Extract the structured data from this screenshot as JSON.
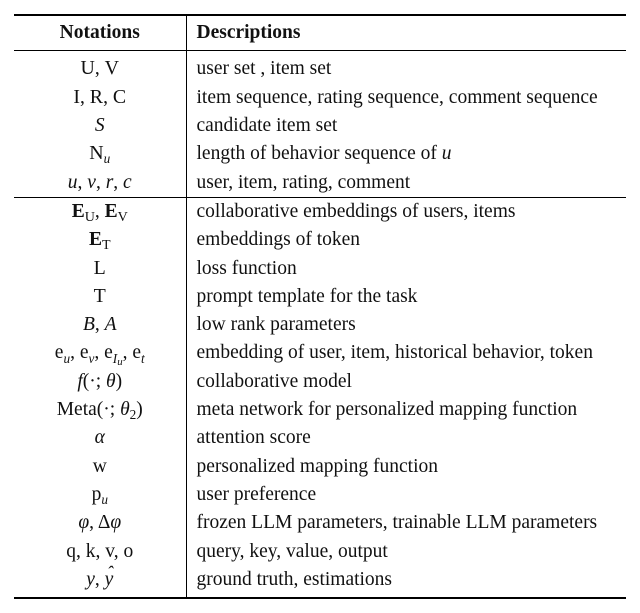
{
  "headers": {
    "notation": "Notations",
    "description": "Descriptions"
  },
  "rows": [
    {
      "n": "𝒰, 𝒱",
      "d": "user set , item set",
      "group_start": false
    },
    {
      "n": "ℐ, ℛ, 𝒞",
      "d": "item sequence, rating sequence, comment sequence"
    },
    {
      "n": "S",
      "d": "candidate item set"
    },
    {
      "n": "𝒩_u",
      "d": "length of behavior sequence of u"
    },
    {
      "n": "u, v, r, c",
      "d": "user, item, rating, comment"
    },
    {
      "n": "E_𝒰, E_𝒱",
      "d": "collaborative embeddings of users, items",
      "group_start": true
    },
    {
      "n": "E_𝒯",
      "d": "embeddings of token"
    },
    {
      "n": "ℒ",
      "d": "loss function"
    },
    {
      "n": "𝒯",
      "d": "prompt template for the task"
    },
    {
      "n": "B, A",
      "d": "low rank parameters"
    },
    {
      "n": "e_u, e_v, e_{I_u}, e_t",
      "d": "embedding of user, item, historical behavior, token"
    },
    {
      "n": "f(·;θ)",
      "d": "collaborative model"
    },
    {
      "n": "Meta(·;θ_2)",
      "d": "meta network for personalized mapping function"
    },
    {
      "n": "α",
      "d": "attention score"
    },
    {
      "n": "w",
      "d": "personalized mapping function"
    },
    {
      "n": "p_u",
      "d": "user preference"
    },
    {
      "n": "φ, Δφ",
      "d": "frozen LLM parameters, trainable LLM parameters"
    },
    {
      "n": "q, k, v, o",
      "d": "query, key, value, output"
    },
    {
      "n": "y, ŷ",
      "d": "ground truth, estimations"
    }
  ],
  "chart_data": {
    "type": "table",
    "title": "Notation table",
    "columns": [
      "Notations",
      "Descriptions"
    ],
    "rows": [
      [
        "𝒰, 𝒱",
        "user set , item set"
      ],
      [
        "ℐ, ℛ, 𝒞",
        "item sequence, rating sequence, comment sequence"
      ],
      [
        "S",
        "candidate item set"
      ],
      [
        "𝒩_u",
        "length of behavior sequence of u"
      ],
      [
        "u, v, r, c",
        "user, item, rating, comment"
      ],
      [
        "E_𝒰, E_𝒱",
        "collaborative embeddings of users, items"
      ],
      [
        "E_𝒯",
        "embeddings of token"
      ],
      [
        "ℒ",
        "loss function"
      ],
      [
        "𝒯",
        "prompt template for the task"
      ],
      [
        "B, A",
        "low rank parameters"
      ],
      [
        "e_u, e_v, e_{I_u}, e_t",
        "embedding of user, item, historical behavior, token"
      ],
      [
        "f(·;θ)",
        "collaborative model"
      ],
      [
        "Meta(·;θ_2)",
        "meta network for personalized mapping function"
      ],
      [
        "α",
        "attention score"
      ],
      [
        "w",
        "personalized mapping function"
      ],
      [
        "p_u",
        "user preference"
      ],
      [
        "φ, Δφ",
        "frozen LLM parameters, trainable LLM parameters"
      ],
      [
        "q, k, v, o",
        "query, key, value, output"
      ],
      [
        "y, ŷ",
        "ground truth, estimations"
      ]
    ]
  }
}
